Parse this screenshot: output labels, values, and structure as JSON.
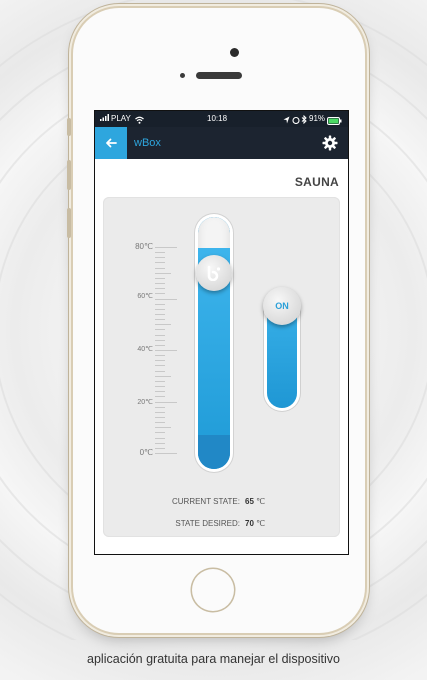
{
  "status_bar": {
    "carrier": "PLAY",
    "time": "10:18",
    "battery": "91%"
  },
  "app_bar": {
    "title": "wBox",
    "back_icon": "arrow-left-icon",
    "settings_icon": "gear-icon"
  },
  "room": {
    "name": "SAUNA"
  },
  "thermometer": {
    "scale": [
      "80℃",
      "60℃",
      "40℃",
      "20℃",
      "0℃"
    ],
    "set_level": 0.875
  },
  "toggle": {
    "label": "ON",
    "state": true
  },
  "states": {
    "current_label": "CURRENT STATE:",
    "current_value": "65",
    "desired_label": "STATE DESIRED:",
    "desired_value": "70",
    "unit": "℃"
  },
  "caption": "aplicación gratuita para manejar el dispositivo",
  "colors": {
    "accent": "#2ea6de",
    "appbar": "#1c2430"
  }
}
